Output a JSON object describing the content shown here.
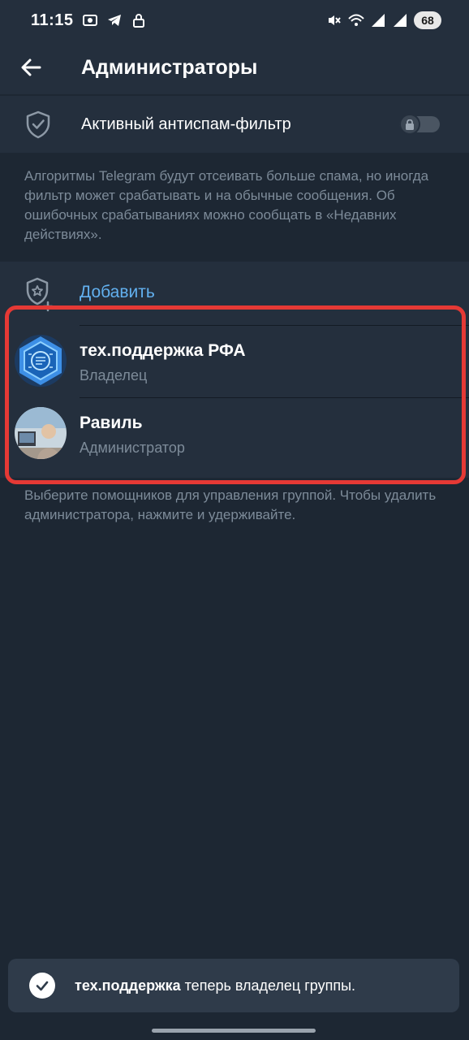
{
  "status_bar": {
    "time": "11:15",
    "battery": "68",
    "left_icons": [
      "screenshot-icon",
      "telegram-icon",
      "lock-icon"
    ],
    "right_icons": [
      "mute-icon",
      "wifi-icon",
      "signal-icon",
      "signal-r-icon"
    ]
  },
  "header": {
    "title": "Администраторы",
    "back_icon": "arrow-left-icon"
  },
  "antispam": {
    "label": "Активный антиспам-фильтр",
    "enabled": false,
    "locked": true,
    "hint": "Алгоритмы Telegram будут отсеивать больше спама, но иногда фильтр может срабатывать и на обычные сообщения. Об ошибочных срабатываниях можно сообщать в «Недавних действиях»."
  },
  "admins": {
    "add_label": "Добавить",
    "list": [
      {
        "name": "тех.поддержка РФА",
        "role": "Владелец"
      },
      {
        "name": "Равиль",
        "role": "Администратор"
      }
    ],
    "hint": "Выберите помощников для управления группой. Чтобы удалить администратора, нажмите и удерживайте."
  },
  "toast": {
    "bold": "тех.поддержка",
    "text": " теперь владелец группы."
  },
  "colors": {
    "background": "#1d2733",
    "panel": "#242f3d",
    "accent": "#62b0ef",
    "secondary_text": "#7d8b99",
    "highlight": "#e53935"
  }
}
